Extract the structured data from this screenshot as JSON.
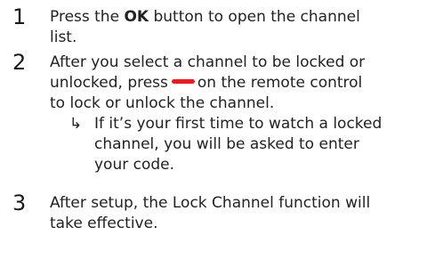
{
  "steps": [
    {
      "number": "1",
      "line1_before": "Press the ",
      "line1_bold": "OK",
      "line1_after": " button to open the channel",
      "line2": "list."
    },
    {
      "number": "2",
      "line1": "After you select a channel to be locked or",
      "line2_before": "unlocked, press",
      "line2_after": "on the remote control",
      "line3": "to lock or unlock the channel.",
      "red_key_color": "#e31e24",
      "note": {
        "arrow_icon": "right-arrow-icon",
        "arrow": "↳",
        "lines": [
          "If it’s your first time to watch a locked",
          "channel, you will be asked to enter",
          "your code."
        ]
      }
    },
    {
      "number": "3",
      "line1": "After setup, the Lock Channel function will",
      "line2": "take effective."
    }
  ]
}
